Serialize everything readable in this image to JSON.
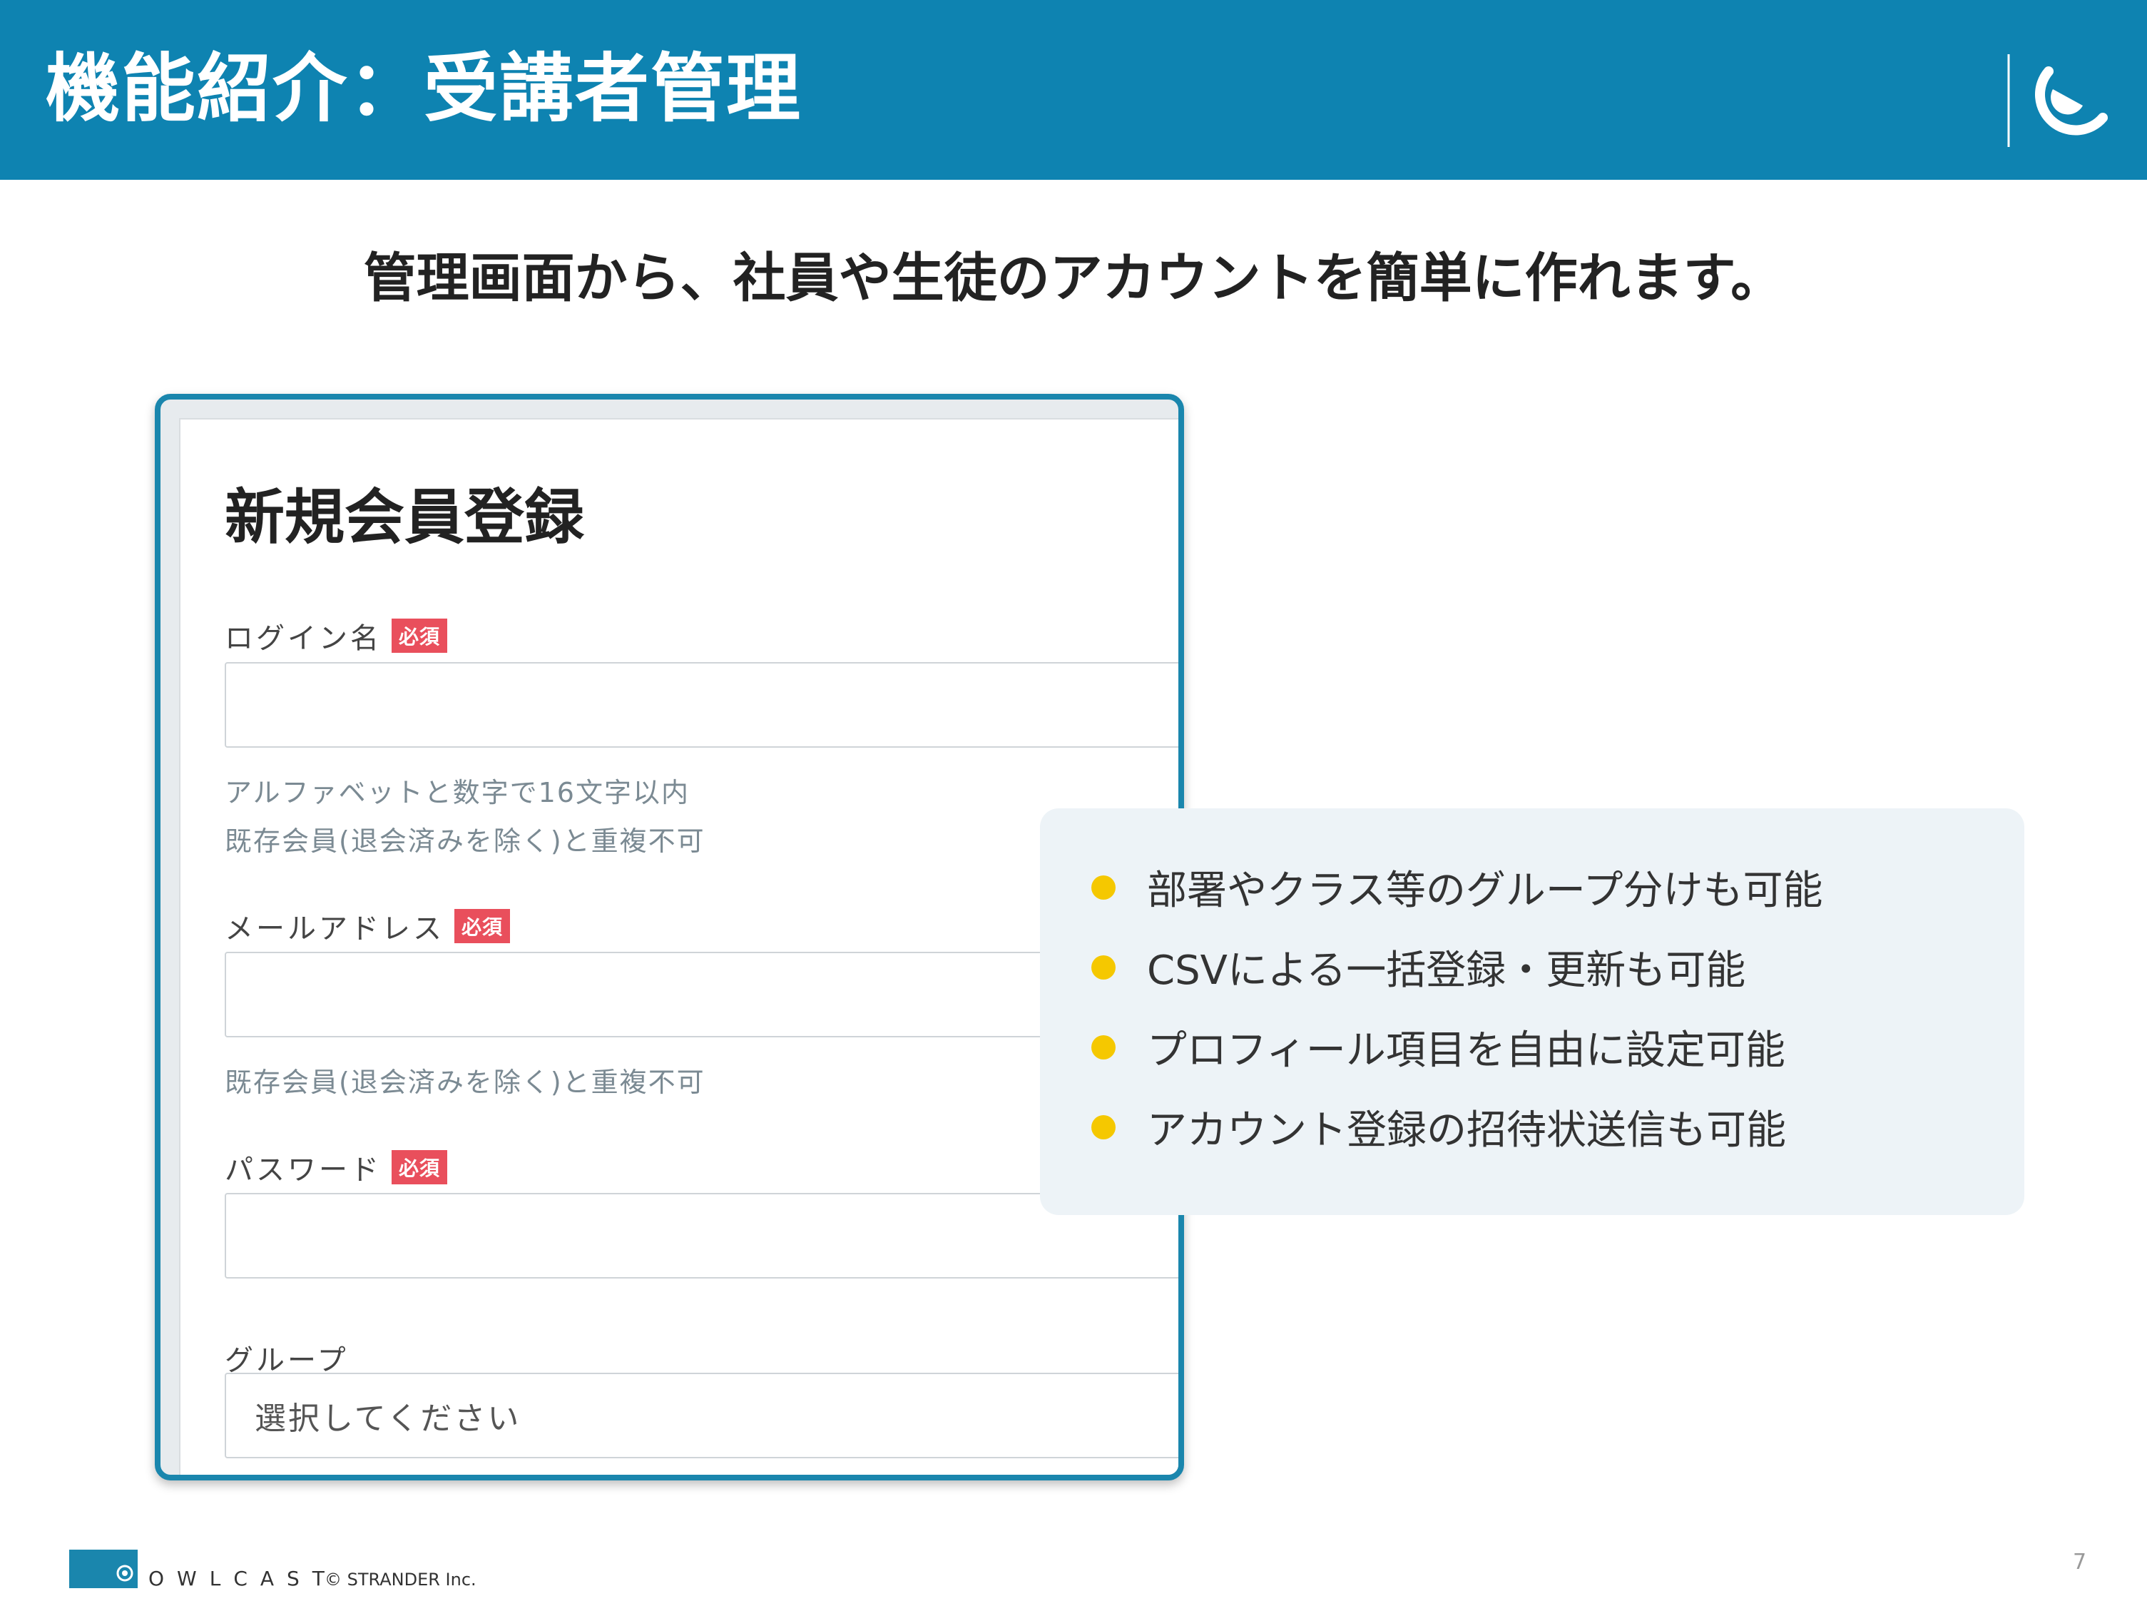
{
  "header": {
    "title": "機能紹介：受講者管理"
  },
  "subtitle": "管理画面から、社員や生徒のアカウントを簡単に作れます。",
  "form": {
    "title": "新規会員登録",
    "required_badge": "必須",
    "fields": [
      {
        "label": "ログイン名",
        "required": true,
        "value": "",
        "hints": [
          "アルファベットと数字で16文字以内",
          "既存会員(退会済みを除く)と重複不可"
        ]
      },
      {
        "label": "メールアドレス",
        "required": true,
        "value": "",
        "hints": [
          "既存会員(退会済みを除く)と重複不可"
        ]
      },
      {
        "label": "パスワード",
        "required": true,
        "value": "",
        "hints": []
      },
      {
        "label": "グループ",
        "required": false,
        "select_value": "選択してください"
      }
    ]
  },
  "features": [
    "部署やクラス等のグループ分けも可能",
    "CSVによる一括登録・更新も可能",
    "プロフィール項目を自由に設定可能",
    "アカウント登録の招待状送信も可能"
  ],
  "colors": {
    "header_bg": "#0e83b1",
    "accent_border": "#1a86ad",
    "required_badge": "#e94f5c",
    "bullet": "#f5c800",
    "panel_bg": "#edf3f7"
  },
  "footer": {
    "brand": "OWLCAST",
    "copyright": "© STRANDER Inc.",
    "page_number": "7"
  }
}
